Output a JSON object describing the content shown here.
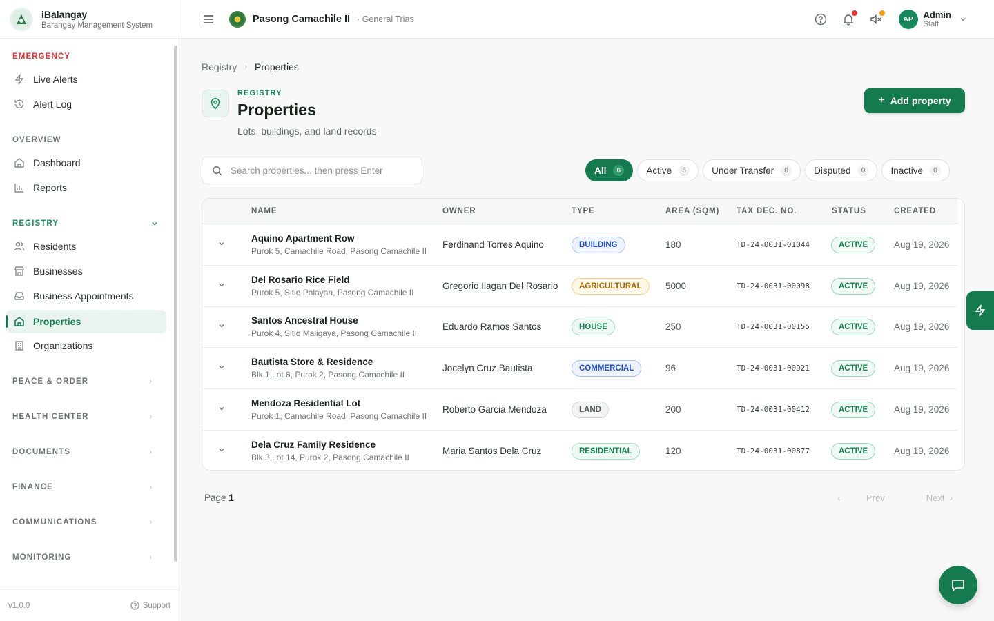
{
  "brand": {
    "name": "iBalangay",
    "subtitle": "Barangay Management System"
  },
  "sidebar": {
    "sections": {
      "emergency": "EMERGENCY",
      "overview": "OVERVIEW",
      "registry": "REGISTRY",
      "peace_order": "PEACE & ORDER",
      "health_center": "HEALTH CENTER",
      "documents": "DOCUMENTS",
      "finance": "FINANCE",
      "communications": "COMMUNICATIONS",
      "monitoring": "MONITORING"
    },
    "items": {
      "live_alerts": "Live Alerts",
      "alert_log": "Alert Log",
      "dashboard": "Dashboard",
      "reports": "Reports",
      "residents": "Residents",
      "businesses": "Businesses",
      "business_appointments": "Business Appointments",
      "properties": "Properties",
      "organizations": "Organizations"
    },
    "version": "v1.0.0",
    "support": "Support"
  },
  "topbar": {
    "barangay": "Pasong Camachile II",
    "city": "· General Trias",
    "user_initials": "AP",
    "user_name": "Admin",
    "user_role": "Staff"
  },
  "breadcrumb": {
    "parent": "Registry",
    "current": "Properties"
  },
  "header": {
    "eyebrow": "REGISTRY",
    "title": "Properties",
    "subtitle": "Lots, buildings, and land records",
    "add_button": "Add property"
  },
  "search": {
    "placeholder": "Search properties... then press Enter",
    "value": ""
  },
  "filters": [
    {
      "label": "All",
      "count": "6"
    },
    {
      "label": "Active",
      "count": "6"
    },
    {
      "label": "Under Transfer",
      "count": "0"
    },
    {
      "label": "Disputed",
      "count": "0"
    },
    {
      "label": "Inactive",
      "count": "0"
    }
  ],
  "table": {
    "columns": [
      "NAME",
      "OWNER",
      "TYPE",
      "AREA (SQM)",
      "TAX DEC. NO.",
      "STATUS",
      "CREATED"
    ],
    "rows": [
      {
        "name": "Aquino Apartment Row",
        "address": "Purok 5, Camachile Road, Pasong Camachile II",
        "owner": "Ferdinand Torres Aquino",
        "type": "BUILDING",
        "area": "180",
        "tax": "TD-24-0031-01044",
        "status": "ACTIVE",
        "created": "Aug 19, 2026"
      },
      {
        "name": "Del Rosario Rice Field",
        "address": "Purok 5, Sitio Palayan, Pasong Camachile II",
        "owner": "Gregorio Ilagan Del Rosario",
        "type": "AGRICULTURAL",
        "area": "5000",
        "tax": "TD-24-0031-00098",
        "status": "ACTIVE",
        "created": "Aug 19, 2026"
      },
      {
        "name": "Santos Ancestral House",
        "address": "Purok 4, Sitio Maligaya, Pasong Camachile II",
        "owner": "Eduardo Ramos Santos",
        "type": "HOUSE",
        "area": "250",
        "tax": "TD-24-0031-00155",
        "status": "ACTIVE",
        "created": "Aug 19, 2026"
      },
      {
        "name": "Bautista Store & Residence",
        "address": "Blk 1 Lot 8, Purok 2, Pasong Camachile II",
        "owner": "Jocelyn Cruz Bautista",
        "type": "COMMERCIAL",
        "area": "96",
        "tax": "TD-24-0031-00921",
        "status": "ACTIVE",
        "created": "Aug 19, 2026"
      },
      {
        "name": "Mendoza Residential Lot",
        "address": "Purok 1, Camachile Road, Pasong Camachile II",
        "owner": "Roberto Garcia Mendoza",
        "type": "LAND",
        "area": "200",
        "tax": "TD-24-0031-00412",
        "status": "ACTIVE",
        "created": "Aug 19, 2026"
      },
      {
        "name": "Dela Cruz Family Residence",
        "address": "Blk 3 Lot 14, Purok 2, Pasong Camachile II",
        "owner": "Maria Santos Dela Cruz",
        "type": "RESIDENTIAL",
        "area": "120",
        "tax": "TD-24-0031-00877",
        "status": "ACTIVE",
        "created": "Aug 19, 2026"
      }
    ]
  },
  "type_colors": {
    "BUILDING": {
      "fg": "#2350b8",
      "bg": "#eef3ff",
      "border": "#aac1f2"
    },
    "AGRICULTURAL": {
      "fg": "#a86a06",
      "bg": "#fff8e8",
      "border": "#f1d18f"
    },
    "HOUSE": {
      "fg": "#1a7f52",
      "bg": "#eef9f3",
      "border": "#a9dcc1"
    },
    "COMMERCIAL": {
      "fg": "#2350b8",
      "bg": "#eef3ff",
      "border": "#aac1f2"
    },
    "LAND": {
      "fg": "#555e59",
      "bg": "#f2f3f3",
      "border": "#d3d7d5"
    },
    "RESIDENTIAL": {
      "fg": "#1a7f52",
      "bg": "#eef9f3",
      "border": "#a9dcc1"
    }
  },
  "status_color": {
    "fg": "#1a7f52",
    "bg": "#eef9f3",
    "border": "#9bd6b7"
  },
  "pager": {
    "label": "Page",
    "page": "1",
    "prev": "Prev",
    "next": "Next"
  }
}
